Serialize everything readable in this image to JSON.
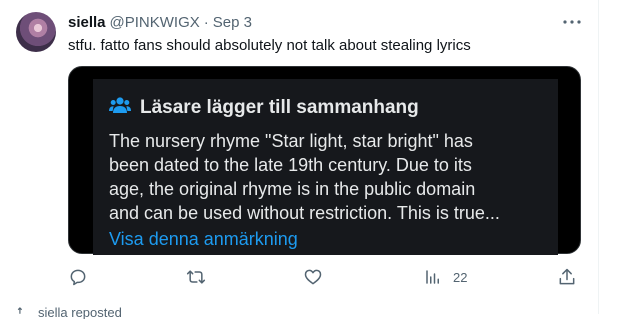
{
  "tweet": {
    "display_name": "siella",
    "handle": "@PINKWIGX",
    "separator": "·",
    "date": "Sep 3",
    "text": "stfu. fatto fans should absolutely not talk about stealing lyrics"
  },
  "community_note": {
    "title": "Läsare lägger till sammanhang",
    "body_lines": [
      "The nursery rhyme \"Star light, star bright\" has",
      "been dated to the late 19th century. Due to its",
      "age, the original rhyme is in the public domain",
      "and can be used without restriction. This is true..."
    ],
    "link_label": "Visa denna anmärkning"
  },
  "actions": {
    "views_count": "22"
  },
  "next_item": {
    "text": "siella reposted"
  },
  "colors": {
    "text_primary": "#0f1419",
    "text_secondary": "#536471",
    "note_text": "#e7e9ea",
    "link": "#1d9bf0",
    "note_card_bg": "#000000",
    "note_inner_bg": "#16181c"
  },
  "icons": [
    "more-icon",
    "readers-icon",
    "reply-icon",
    "retweet-icon",
    "like-icon",
    "views-icon",
    "share-icon",
    "repost-icon"
  ]
}
